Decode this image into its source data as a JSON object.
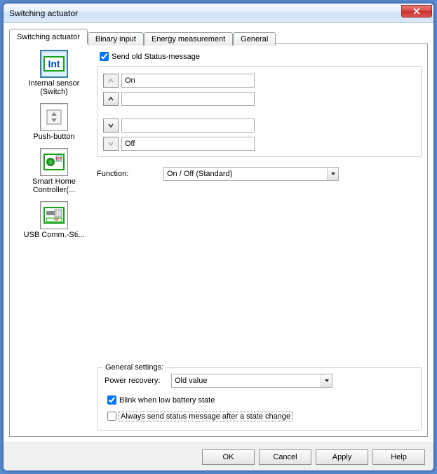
{
  "window": {
    "title": "Switching actuator"
  },
  "tabs": [
    {
      "label": "Switching actuator"
    },
    {
      "label": "Binary input"
    },
    {
      "label": "Energy measurement"
    },
    {
      "label": "General"
    }
  ],
  "sidebar": {
    "items": [
      {
        "label": "Internal sensor (Switch)",
        "icon": "int-icon"
      },
      {
        "label": "Push-button",
        "icon": "push-icon"
      },
      {
        "label": "Smart Home Controller(...",
        "icon": "shc-icon"
      },
      {
        "label": "USB Comm.-Sti...",
        "icon": "usb-icon"
      }
    ]
  },
  "main": {
    "send_old_status_label": "Send old Status-message",
    "send_old_status_checked": true,
    "rows": {
      "r0": "On",
      "r1": "",
      "r2": "",
      "r3": "Off"
    },
    "function_label": "Function:",
    "function_value": "On / Off (Standard)"
  },
  "general_settings": {
    "legend": "General settings:",
    "power_recovery_label": "Power recovery:",
    "power_recovery_value": "Old value",
    "blink_label": "Blink when low battery state",
    "blink_checked": true,
    "always_send_label": "Always send status message after a state change",
    "always_send_checked": false
  },
  "buttons": {
    "ok": "OK",
    "cancel": "Cancel",
    "apply": "Apply",
    "help": "Help"
  }
}
